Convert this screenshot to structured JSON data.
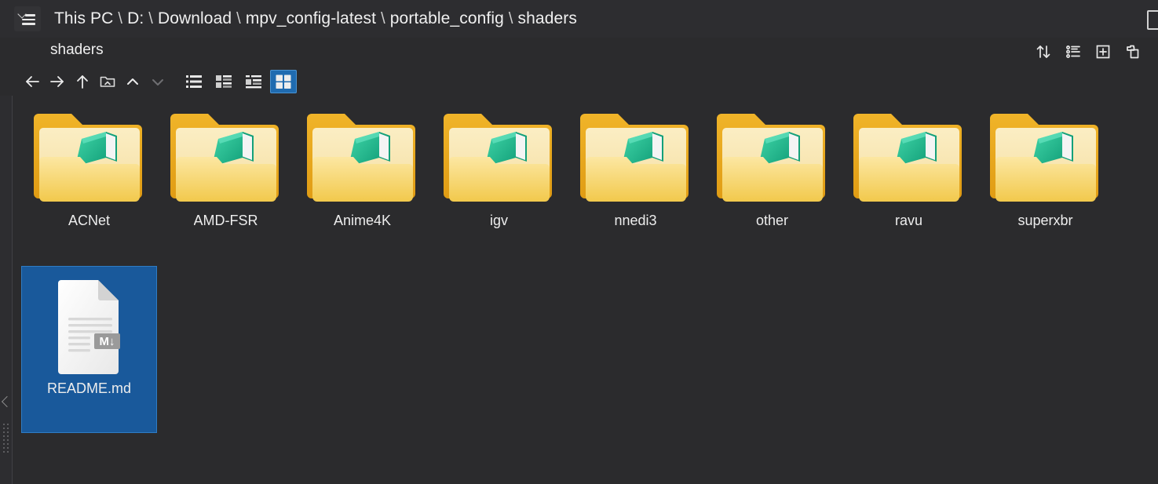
{
  "window": {
    "menu_icon": "hamburger-menu-icon",
    "theme_background": "#2b2b2d",
    "header_background": "#2d2d30",
    "accent_color": "#1f6bb0",
    "selection_color": "#19599b"
  },
  "breadcrumb": {
    "separator": "\\",
    "items": [
      {
        "label": "This PC"
      },
      {
        "label": "D:"
      },
      {
        "label": "Download"
      },
      {
        "label": "mpv_config-latest"
      },
      {
        "label": "portable_config"
      },
      {
        "label": "shaders"
      }
    ]
  },
  "title_row": {
    "folder_name": "shaders",
    "tools": [
      {
        "name": "sort-icon",
        "tooltip": "Sort"
      },
      {
        "name": "list-details-icon",
        "tooltip": "Details"
      },
      {
        "name": "new-item-icon",
        "tooltip": "New"
      },
      {
        "name": "paste-clipboard-icon",
        "tooltip": "Paste"
      }
    ]
  },
  "nav_bar": {
    "buttons": [
      {
        "name": "back-button",
        "icon": "arrow-left-icon",
        "enabled": true
      },
      {
        "name": "forward-button",
        "icon": "arrow-right-icon",
        "enabled": true
      },
      {
        "name": "up-button",
        "icon": "arrow-up-icon",
        "enabled": true
      },
      {
        "name": "folder-history-button",
        "icon": "folder-chevron-icon",
        "enabled": true
      },
      {
        "name": "scroll-up-button",
        "icon": "chevron-up-icon",
        "enabled": true
      },
      {
        "name": "scroll-down-button",
        "icon": "chevron-down-icon",
        "enabled": false
      }
    ],
    "view_modes": [
      {
        "name": "view-list",
        "icon": "list-view-icon",
        "selected": false
      },
      {
        "name": "view-tiles",
        "icon": "tiles-view-icon",
        "selected": false
      },
      {
        "name": "view-details",
        "icon": "details-view-icon",
        "selected": false
      },
      {
        "name": "view-icons",
        "icon": "large-icons-view-icon",
        "selected": true
      }
    ]
  },
  "sidebar_strip": {
    "collapse_icon": "chevron-left-icon",
    "grip_icon": "drag-handle-icon"
  },
  "files": [
    {
      "name": "ACNet",
      "type": "folder",
      "selected": false
    },
    {
      "name": "AMD-FSR",
      "type": "folder",
      "selected": false
    },
    {
      "name": "Anime4K",
      "type": "folder",
      "selected": false
    },
    {
      "name": "igv",
      "type": "folder",
      "selected": false
    },
    {
      "name": "nnedi3",
      "type": "folder",
      "selected": false
    },
    {
      "name": "other",
      "type": "folder",
      "selected": false
    },
    {
      "name": "ravu",
      "type": "folder",
      "selected": false
    },
    {
      "name": "superxbr",
      "type": "folder",
      "selected": false
    },
    {
      "name": "README.md",
      "type": "markdown",
      "selected": true,
      "badge": "M↓"
    }
  ],
  "icon_colors": {
    "folder_back": "#f0b429",
    "folder_back_dark": "#e09c14",
    "folder_inner": "#f7e3ac",
    "folder_front": "#f9da8a",
    "folder_front_edge": "#f2c94c",
    "book_teal": "#2bbd94",
    "book_teal_dark": "#13a07a",
    "book_page": "#f4f4f4",
    "doc_paper": "#f2f2f2",
    "doc_line": "#d8d8d8",
    "md_badge": "#9a9a9a"
  }
}
